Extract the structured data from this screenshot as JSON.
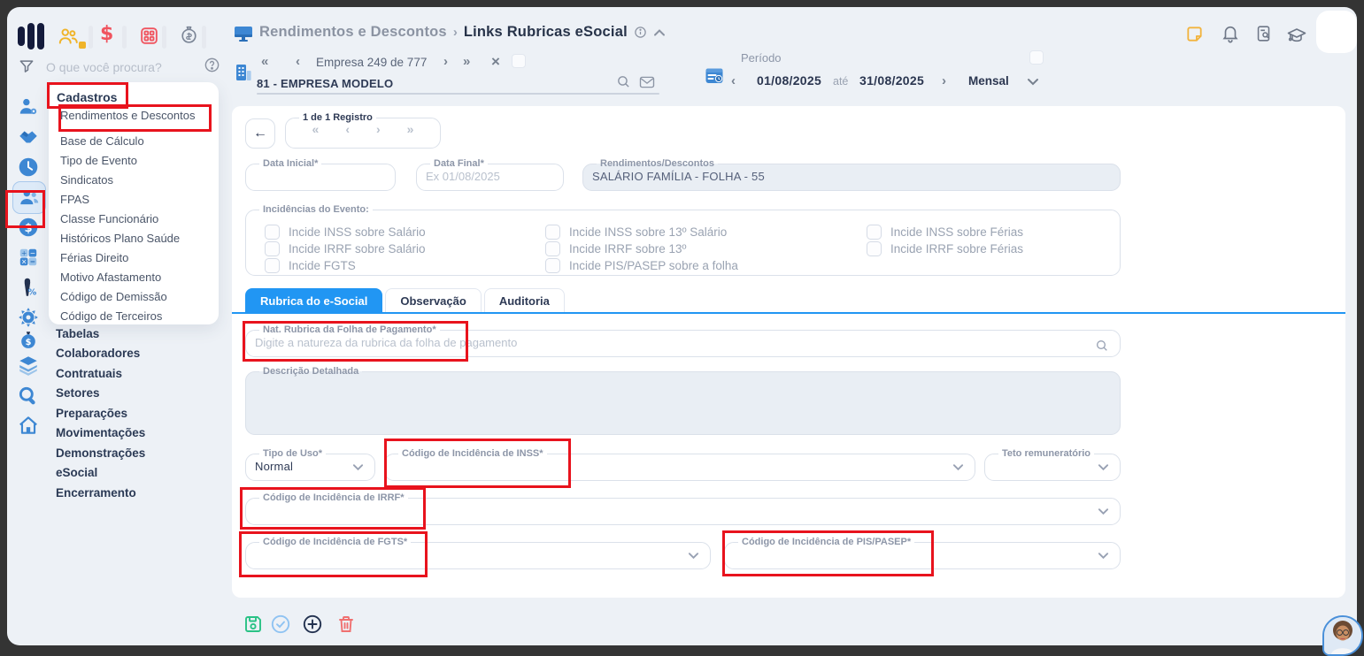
{
  "header": {
    "breadcrumb_section": "Rendimentos e Descontos",
    "breadcrumb_separator": "›",
    "page_title": "Links Rubricas eSocial",
    "search_placeholder": "O que você procura?"
  },
  "company_bar": {
    "first": "«",
    "prev": "‹",
    "label": "Empresa 249 de 777",
    "next": "›",
    "last": "»",
    "close": "×",
    "name": "81 - EMPRESA MODELO"
  },
  "period_bar": {
    "label": "Período",
    "prev": "‹",
    "start_date": "01/08/2025",
    "until": "até",
    "end_date": "31/08/2025",
    "next": "›",
    "mode": "Mensal"
  },
  "menu": {
    "section": "Cadastros",
    "items": [
      "Rendimentos e Descontos",
      "Base de Cálculo",
      "Tipo de Evento",
      "Sindicatos",
      "FPAS",
      "Classe Funcionário",
      "Históricos Plano Saúde",
      "Férias Direito",
      "Motivo Afastamento",
      "Código de Demissão",
      "Código de Terceiros"
    ],
    "sections_below": [
      "Tabelas",
      "Colaboradores",
      "Contratuais",
      "Setores",
      "Preparações",
      "Movimentações",
      "Demonstrações",
      "eSocial",
      "Encerramento"
    ]
  },
  "record_nav": {
    "legend": "1 de 1 Registro",
    "back": "←",
    "first": "«",
    "prev": "‹",
    "next": "›",
    "last": "»"
  },
  "form": {
    "data_inicial": {
      "label": "Data Inicial*"
    },
    "data_final": {
      "label": "Data Final*",
      "placeholder": "Ex 01/08/2025"
    },
    "rendimentos": {
      "label": "Rendimentos/Descontos",
      "value": "SALÁRIO FAMÍLIA - FOLHA - 55"
    },
    "incidencias": {
      "legend": "Incidências do Evento:",
      "col1": [
        "Incide INSS sobre Salário",
        "Incide IRRF sobre Salário",
        "Incide FGTS"
      ],
      "col2": [
        "Incide INSS sobre 13º Salário",
        "Incide IRRF sobre 13º",
        "Incide PIS/PASEP sobre a folha"
      ],
      "col3": [
        "Incide INSS sobre Férias",
        "Incide IRRF sobre Férias"
      ]
    },
    "tabs": [
      "Rubrica do e-Social",
      "Observação",
      "Auditoria"
    ],
    "nat_rubrica": {
      "label": "Nat. Rubrica da Folha de Pagamento*",
      "placeholder": "Digite a natureza da rubrica da folha de pagamento"
    },
    "descricao": {
      "label": "Descrição Detalhada"
    },
    "tipo_uso": {
      "label": "Tipo de Uso*",
      "value": "Normal"
    },
    "cod_inss": {
      "label": "Código de Incidência de INSS*"
    },
    "teto": {
      "label": "Teto remuneratório"
    },
    "cod_irrf": {
      "label": "Código de Incidência de IRRF*"
    },
    "cod_fgts": {
      "label": "Código de Incidência de FGTS*"
    },
    "cod_pis": {
      "label": "Código de Incidência de PIS/PASEP*"
    }
  },
  "colors": {
    "accent_blue": "#2196f3",
    "annotation_red": "#e8131d",
    "icon_blue": "#3d87d3",
    "icon_yellow": "#f0b429",
    "icon_red": "#f0545f",
    "save_green": "#29c285",
    "trash_red": "#f07070",
    "disabled_bg": "#e9eef4"
  }
}
